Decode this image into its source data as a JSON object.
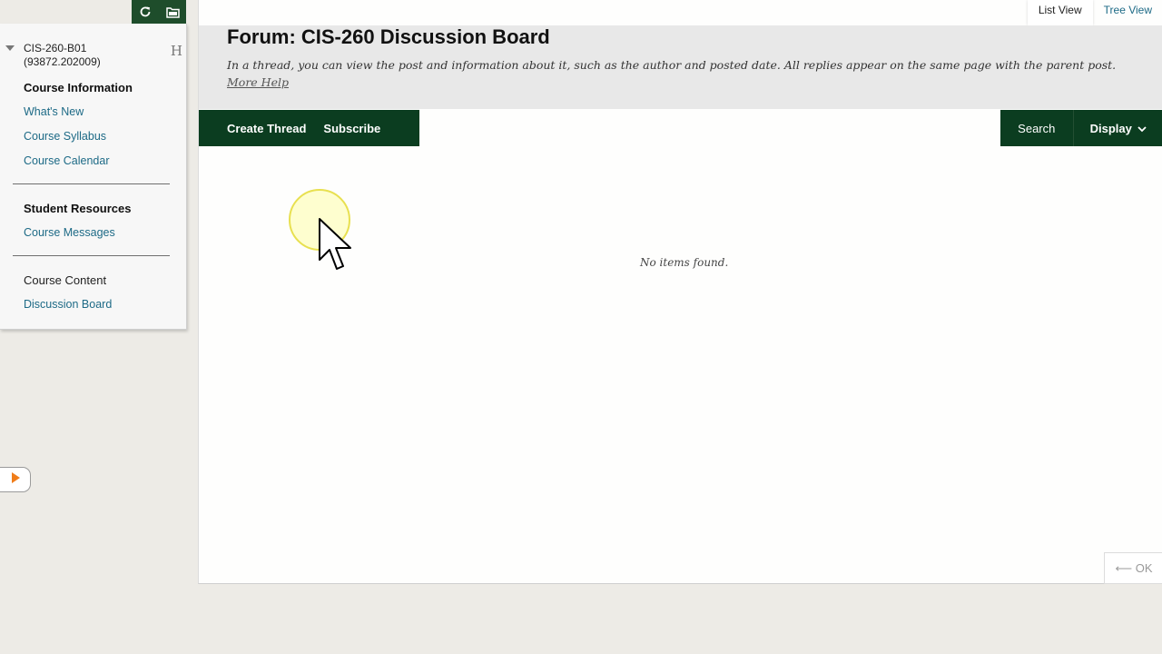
{
  "course_menu": {
    "course_id": "CIS-260-B01",
    "course_code": "(93872.202009)",
    "hide_glyph": "H",
    "sections": [
      {
        "heading": "Course Information",
        "links": [
          "What's New",
          "Course Syllabus",
          "Course Calendar"
        ]
      },
      {
        "heading": "Student Resources",
        "links": [
          "Course Messages"
        ]
      },
      {
        "heading": "Course Content",
        "links": [
          "Discussion Board"
        ]
      }
    ]
  },
  "view_tabs": {
    "list_view": "List View",
    "tree_view": "Tree View",
    "active": "list_view"
  },
  "forum": {
    "title": "Forum: CIS-260 Discussion Board",
    "description": "In a thread, you can view the post and information about it, such as the author and posted date. All replies appear on the same page with the parent post.",
    "more_help": "More Help"
  },
  "action_bar": {
    "create_thread": "Create Thread",
    "subscribe": "Subscribe",
    "search": "Search",
    "display": "Display"
  },
  "empty_message": "No items found.",
  "ok_button": "⟵ OK",
  "colors": {
    "brand_dark_green": "#0b3d20",
    "link_teal": "#1d6a86",
    "header_gray": "#e8e8e8"
  }
}
